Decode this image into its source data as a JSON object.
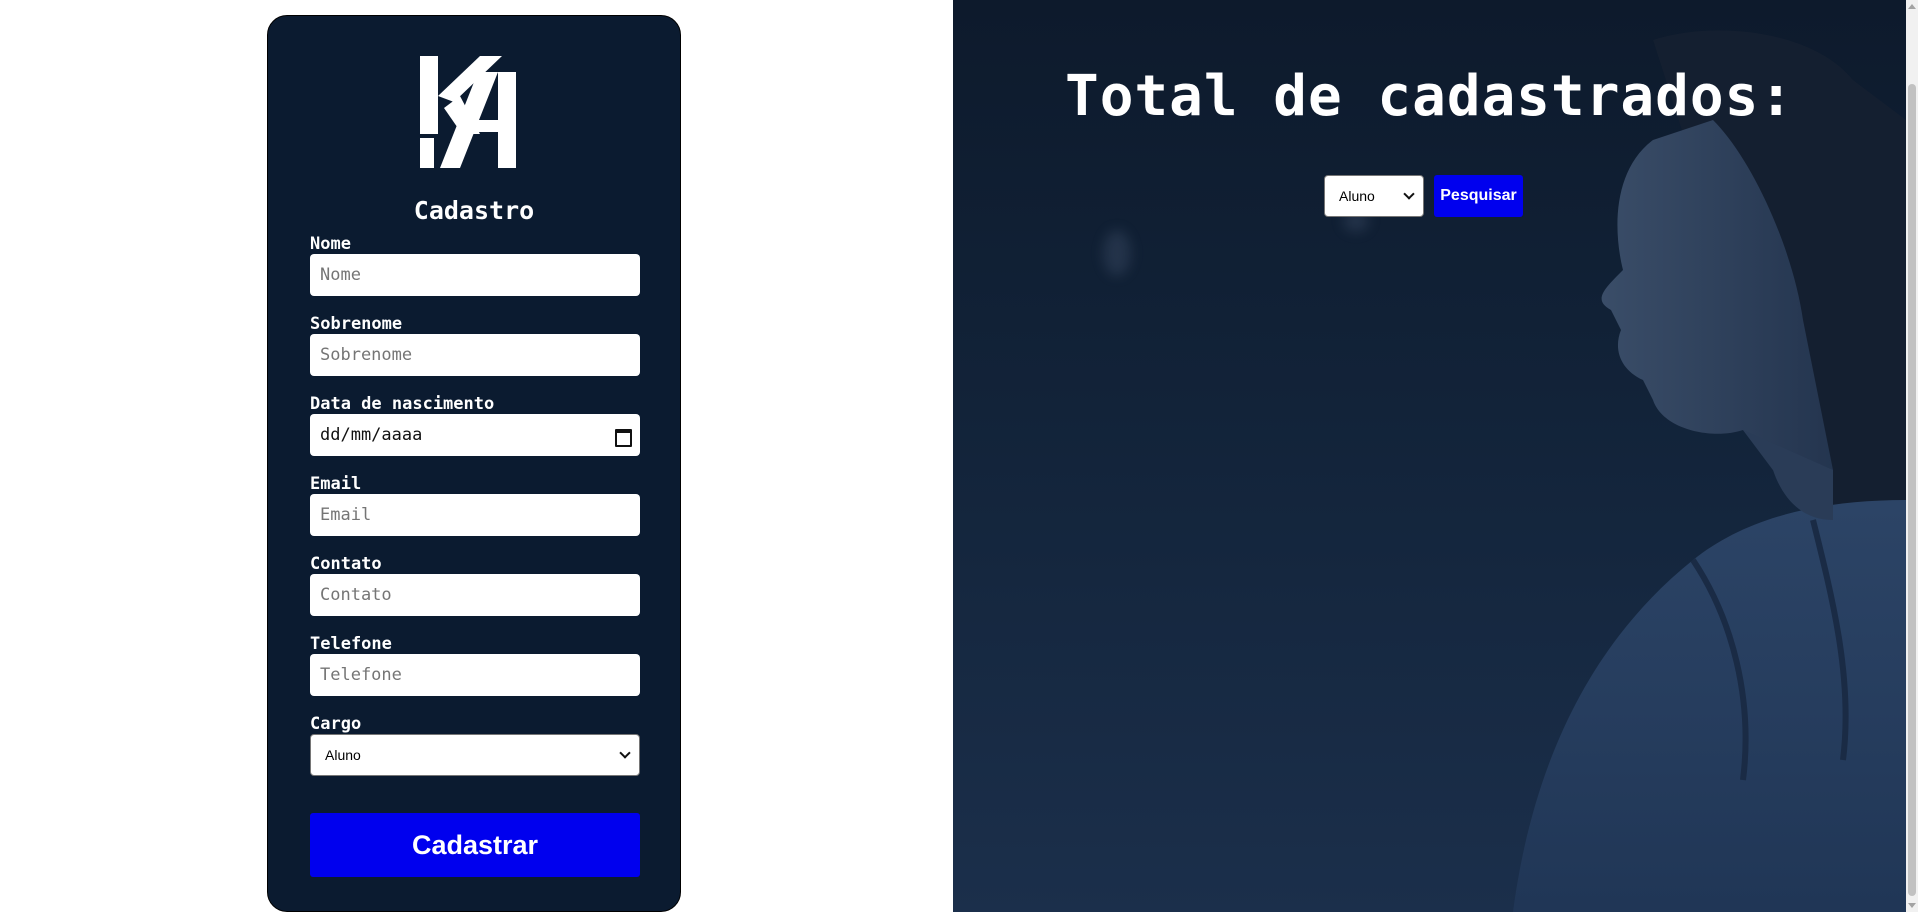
{
  "form": {
    "title": "Cadastro",
    "logo_text": "KA",
    "fields": {
      "nome": {
        "label": "Nome",
        "placeholder": "Nome"
      },
      "sobrenome": {
        "label": "Sobrenome",
        "placeholder": "Sobrenome"
      },
      "nascimento": {
        "label": "Data de nascimento",
        "value": "dd/mm/aaaa"
      },
      "email": {
        "label": "Email",
        "placeholder": "Email"
      },
      "contato": {
        "label": "Contato",
        "placeholder": "Contato"
      },
      "telefone": {
        "label": "Telefone",
        "placeholder": "Telefone"
      },
      "cargo": {
        "label": "Cargo",
        "value": "Aluno"
      }
    },
    "submit_label": "Cadastrar"
  },
  "hero": {
    "title": "Total de cadastrados:",
    "filter_value": "Aluno",
    "search_label": "Pesquisar"
  },
  "colors": {
    "card_bg": "#0b1b30",
    "accent_button": "#0000ee",
    "hero_bg": "#122339"
  },
  "icons": {
    "logo": "ka-logo",
    "date": "calendar-icon",
    "select": "chevron-down-icon"
  }
}
